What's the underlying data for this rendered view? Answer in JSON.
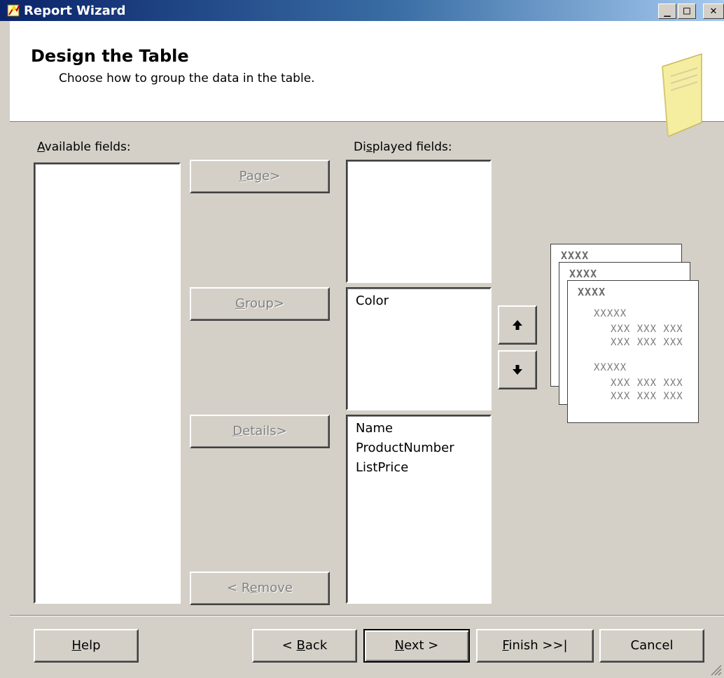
{
  "window": {
    "title": "Report Wizard",
    "min_glyph": "_",
    "max_glyph": "□",
    "close_glyph": "✕"
  },
  "header": {
    "title": "Design the Table",
    "subtitle": "Choose how to group the data in the table."
  },
  "labels": {
    "available_prefix": "A",
    "available_rest": "vailable fields:",
    "displayed_prefix": "Di",
    "displayed_accel": "s",
    "displayed_rest": "played fields:"
  },
  "lists": {
    "available": [],
    "page": [],
    "group": [
      "Color"
    ],
    "details": [
      "Name",
      "ProductNumber",
      "ListPrice"
    ]
  },
  "move_buttons": {
    "page": {
      "accel": "P",
      "rest": "age>"
    },
    "group": {
      "accel": "G",
      "rest": "roup>"
    },
    "details": {
      "accel": "D",
      "rest": "etails>"
    },
    "remove": {
      "pre": "< R",
      "accel": "e",
      "rest": "move"
    }
  },
  "reorder": {
    "up_glyph": "🡅",
    "down_glyph": "🡇"
  },
  "preview": {
    "header_text": "XXXX",
    "group_text": "XXXXX",
    "detail_text": "XXX XXX XXX"
  },
  "footer": {
    "help": {
      "accel": "H",
      "rest": "elp"
    },
    "back": {
      "pre": "< ",
      "accel": "B",
      "rest": "ack"
    },
    "next": {
      "accel": "N",
      "rest": "ext >"
    },
    "finish": {
      "accel": "F",
      "rest": "inish >>|"
    },
    "cancel": "Cancel"
  },
  "colors": {
    "title_start": "#0a246a",
    "title_end": "#a6caf0",
    "face": "#d4d0c8",
    "disabled_text": "#808080"
  }
}
